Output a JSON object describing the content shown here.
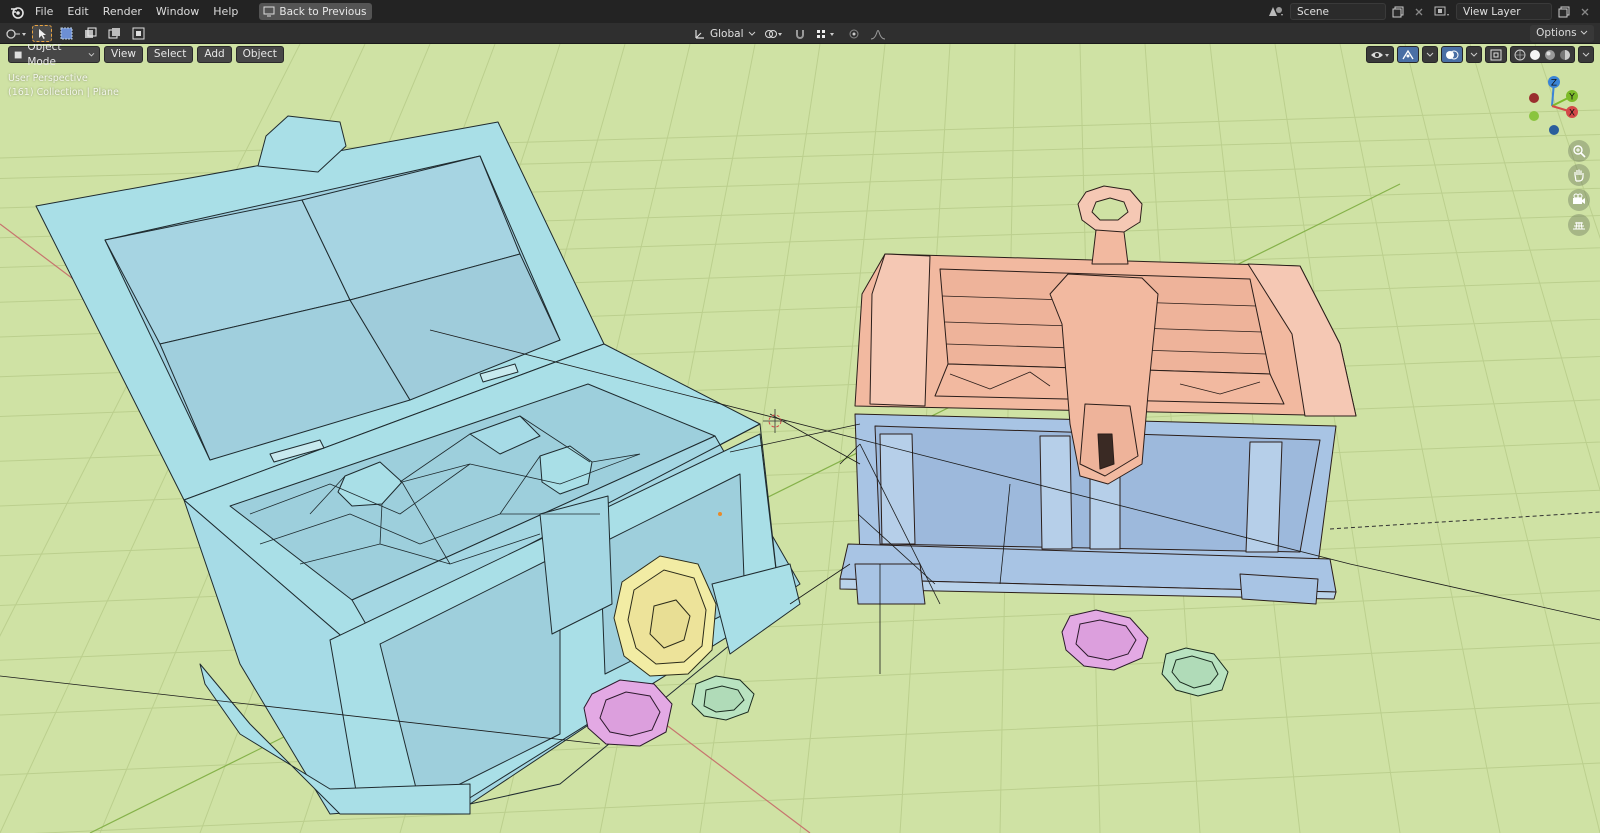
{
  "menu": {
    "items": [
      "File",
      "Edit",
      "Render",
      "Window",
      "Help"
    ],
    "back_button": "Back to Previous"
  },
  "top_right": {
    "scene": "Scene",
    "view_layer": "View Layer"
  },
  "tool_header": {
    "orientation": "Global",
    "options": "Options"
  },
  "viewport": {
    "mode": "Object Mode",
    "menus": [
      "View",
      "Select",
      "Add",
      "Object"
    ],
    "info_line1": "User Perspective",
    "info_line2": "(161) Collection | Plane",
    "gizmo": {
      "z": "Z",
      "y": "Y",
      "x": "X"
    }
  },
  "colors": {
    "viewport_bg": "#cfe2a4",
    "chest_open": "#a9dfe7",
    "chest_closed_body": "#a8c4e4",
    "chest_closed_lid": "#f2b9a0",
    "coin_yellow": "#f2eca4",
    "coin_pink": "#e3a9e4",
    "coin_green": "#b9e3c0",
    "axis_x": "#d44848",
    "axis_y": "#7dbb2a",
    "axis_z": "#3a84d6"
  },
  "icons": [
    "blender-icon",
    "select-box-icon",
    "cursor-icon",
    "transform-pivot-icon",
    "snap-icon",
    "proportional-icon",
    "visibility-icon",
    "gizmo-icon",
    "overlay-icon",
    "xray-icon",
    "shading-wire-icon",
    "shading-solid-icon",
    "shading-material-icon",
    "shading-render-icon",
    "zoom-icon",
    "pan-icon",
    "camera-icon",
    "grid-icon"
  ]
}
